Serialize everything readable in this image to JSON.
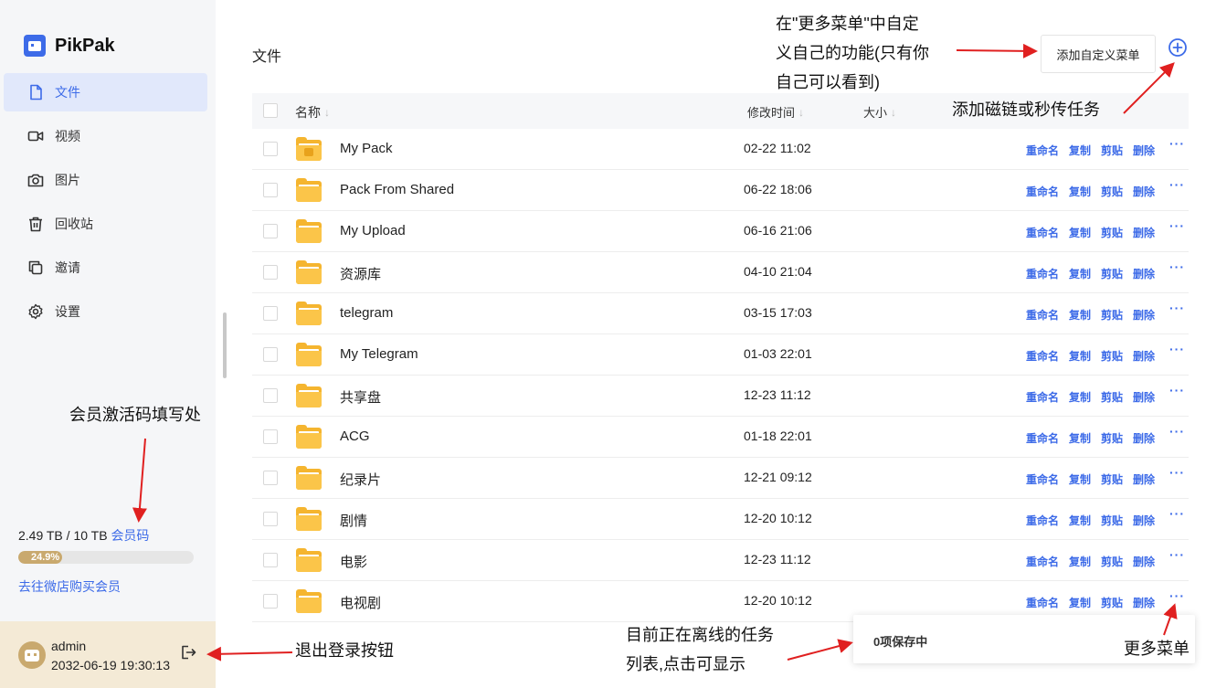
{
  "app": {
    "name": "PikPak"
  },
  "sidebar": {
    "items": [
      {
        "label": "文件",
        "icon": "file-icon",
        "active": true
      },
      {
        "label": "视频",
        "icon": "video-icon"
      },
      {
        "label": "图片",
        "icon": "camera-icon"
      },
      {
        "label": "回收站",
        "icon": "trash-icon"
      },
      {
        "label": "邀请",
        "icon": "copy-icon"
      },
      {
        "label": "设置",
        "icon": "gear-icon"
      }
    ],
    "storage": {
      "used": "2.49 TB / 10 TB",
      "code_link": "会员码",
      "percent_label": "24.9%",
      "percent": 24.9
    },
    "buy_link": "去往微店购买会员",
    "user": {
      "name": "admin",
      "expire": "2032-06-19 19:30:13"
    }
  },
  "main": {
    "title": "文件",
    "custom_menu_button": "添加自定义菜单",
    "columns": {
      "name": "名称",
      "modified": "修改时间",
      "size": "大小"
    },
    "actions": {
      "rename": "重命名",
      "copy": "复制",
      "cut": "剪贴",
      "delete": "删除",
      "more": "···"
    },
    "files": [
      {
        "name": "My Pack",
        "time": "02-22 11:02"
      },
      {
        "name": "Pack From Shared",
        "time": "06-22 18:06"
      },
      {
        "name": "My Upload",
        "time": "06-16 21:06"
      },
      {
        "name": "资源库",
        "time": "04-10 21:04"
      },
      {
        "name": "telegram",
        "time": "03-15 17:03"
      },
      {
        "name": "My Telegram",
        "time": "01-03 22:01"
      },
      {
        "name": "共享盘",
        "time": "12-23 11:12"
      },
      {
        "name": "ACG",
        "time": "01-18 22:01"
      },
      {
        "name": "纪录片",
        "time": "12-21 09:12"
      },
      {
        "name": "剧情",
        "time": "12-20 10:12"
      },
      {
        "name": "电影",
        "time": "12-23 11:12"
      },
      {
        "name": "电视剧",
        "time": "12-20 10:12"
      }
    ],
    "offline_status": "0项保存中"
  },
  "annotations": {
    "more_menu_custom": [
      "在\"更多菜单\"中自定",
      "义自己的功能(只有你",
      "自己可以看到)"
    ],
    "add_magnet": "添加磁链或秒传任务",
    "member_code": "会员激活码填写处",
    "logout": "退出登录按钮",
    "offline_list": [
      "目前正在离线的任务",
      "列表,点击可显示"
    ],
    "more_menu": "更多菜单"
  },
  "colors": {
    "accent": "#3d6be8",
    "folder": "#f5b52f",
    "gold": "#c9a96e",
    "arrow": "#e02020"
  }
}
